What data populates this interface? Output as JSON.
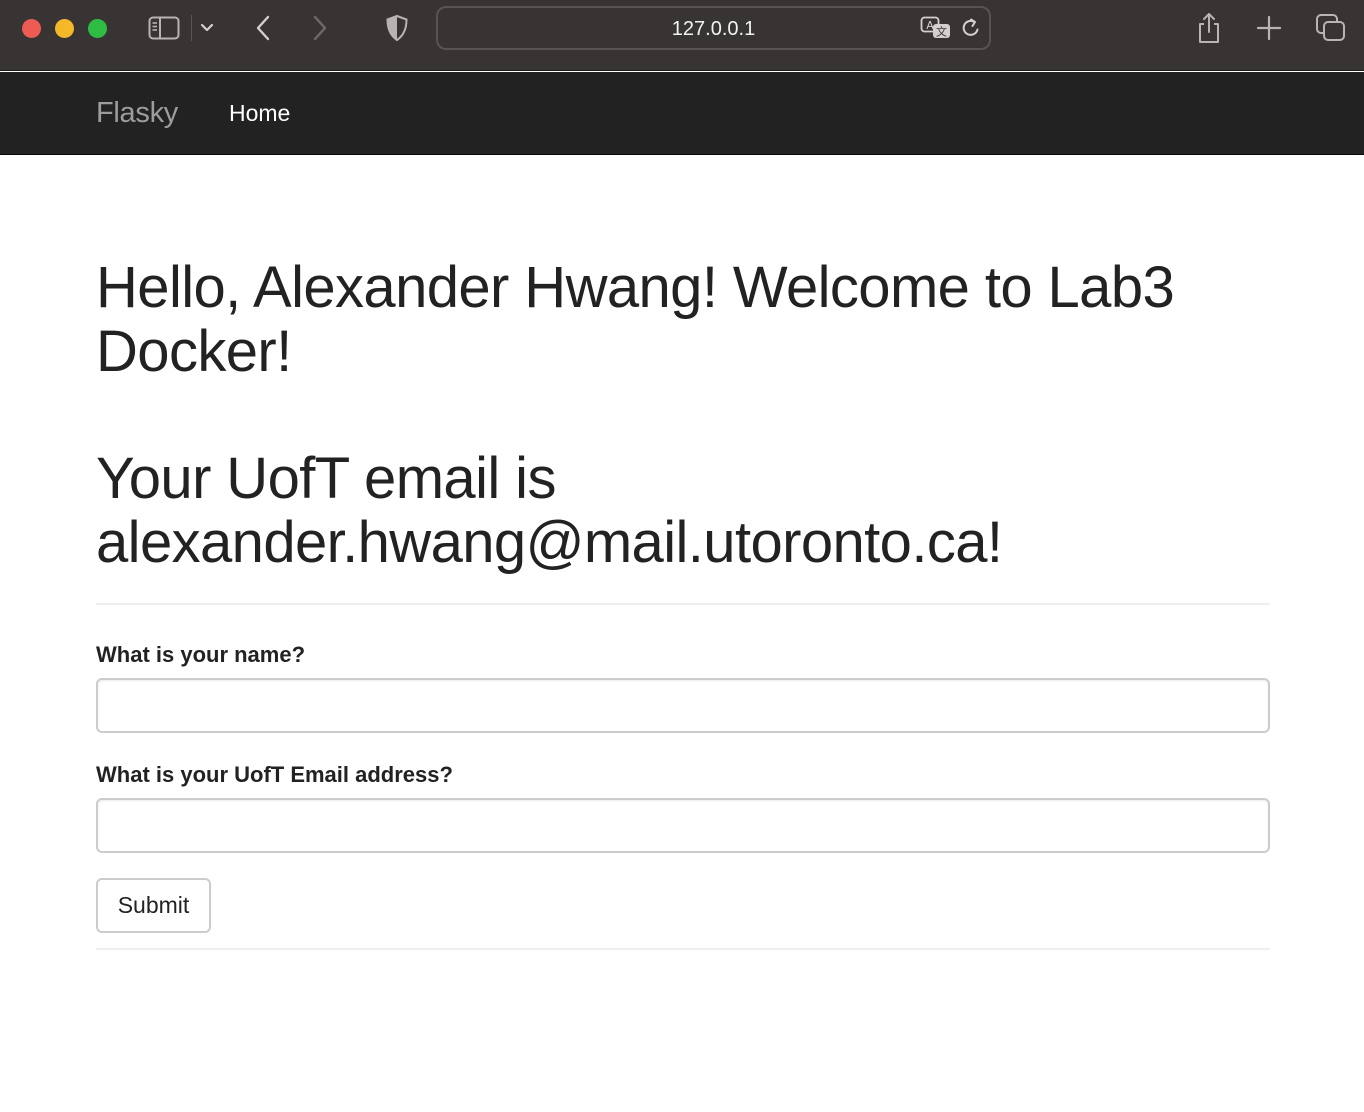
{
  "browser": {
    "url": "127.0.0.1",
    "icons": {
      "sidebar": "sidebar-icon",
      "dropdown": "chevron-down-icon",
      "back": "back-arrow-icon",
      "forward": "forward-arrow-icon",
      "privacy": "shield-icon",
      "translate": "translate-icon",
      "reload": "reload-icon",
      "share": "share-icon",
      "new_tab": "plus-icon",
      "tab_overview": "tabs-icon"
    }
  },
  "navbar": {
    "brand": "Flasky",
    "home": "Home"
  },
  "main": {
    "greeting": "Hello, Alexander Hwang! Welcome to Lab3 Docker!",
    "email_message": "Your UofT email is alexander.hwang@mail.utoronto.ca!"
  },
  "form": {
    "name_label": "What is your name?",
    "name_value": "",
    "email_label": "What is your UofT Email address?",
    "email_value": "",
    "submit_label": "Submit"
  },
  "colors": {
    "navbar_bg": "#222222",
    "brand_text": "#9d9d9d",
    "chrome_bg": "#383434"
  }
}
